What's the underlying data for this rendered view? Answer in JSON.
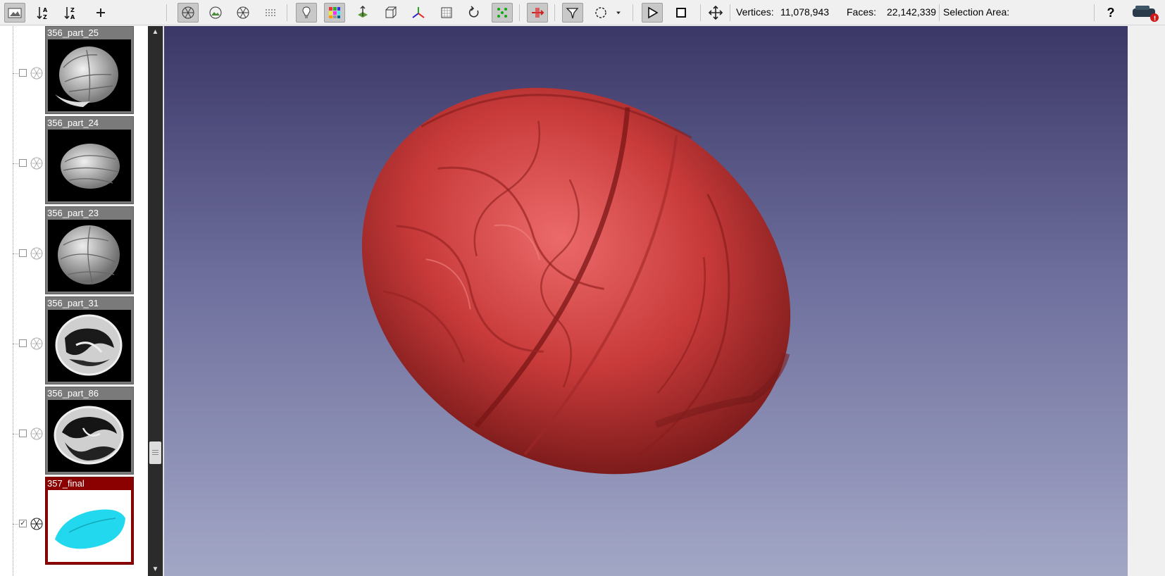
{
  "toolbar": {
    "buttons": [
      {
        "icon": "layer-dialog-icon",
        "pressed": true
      },
      {
        "icon": "sort-ascending-icon"
      },
      {
        "icon": "sort-descending-icon"
      },
      {
        "icon": "add-icon"
      },
      {
        "icon": "points-render-icon",
        "pressed": true
      },
      {
        "icon": "wireframe-render-icon"
      },
      {
        "icon": "flat-render-icon"
      },
      {
        "icon": "smooth-render-icon"
      },
      {
        "icon": "light-bulb-icon",
        "pressed": true
      },
      {
        "icon": "color-grid-icon",
        "pressed": true
      },
      {
        "icon": "transform-icon"
      },
      {
        "icon": "bounding-box-icon"
      },
      {
        "icon": "axes-icon"
      },
      {
        "icon": "texture-icon"
      },
      {
        "icon": "rotate-icon"
      },
      {
        "icon": "vertex-select-icon",
        "pressed": true
      },
      {
        "icon": "measure-icon",
        "pressed": true
      },
      {
        "icon": "select-faces-icon",
        "pressed": true
      },
      {
        "icon": "select-circle-icon"
      },
      {
        "icon": "dropdown-arrow-icon"
      },
      {
        "icon": "play-icon",
        "pressed": true
      },
      {
        "icon": "stop-icon"
      },
      {
        "icon": "move-icon"
      }
    ],
    "vertices_label": "Vertices:",
    "vertices_value": "11,078,943",
    "faces_label": "Faces:",
    "faces_value": "22,142,339",
    "selection_area_label": "Selection Area:",
    "help_label": "?"
  },
  "layers": [
    {
      "name": "356_part_25",
      "visible": false,
      "selected": false,
      "thumb": "whole-walnut"
    },
    {
      "name": "356_part_24",
      "visible": false,
      "selected": false,
      "thumb": "whole-walnut"
    },
    {
      "name": "356_part_23",
      "visible": false,
      "selected": false,
      "thumb": "whole-walnut"
    },
    {
      "name": "356_part_31",
      "visible": false,
      "selected": false,
      "thumb": "walnut-section"
    },
    {
      "name": "356_part_86",
      "visible": false,
      "selected": false,
      "thumb": "walnut-section"
    },
    {
      "name": "357_final",
      "visible": true,
      "selected": true,
      "thumb": "cyan-mesh"
    }
  ],
  "viewport": {
    "model": "walnut-mesh",
    "model_color": "#c83a3a",
    "background_top": "#3b3767",
    "background_bottom": "#a3a7c6"
  },
  "colors": {
    "selected_layer": "#8b0000",
    "selected_mesh_thumb": "#22d8ee"
  }
}
